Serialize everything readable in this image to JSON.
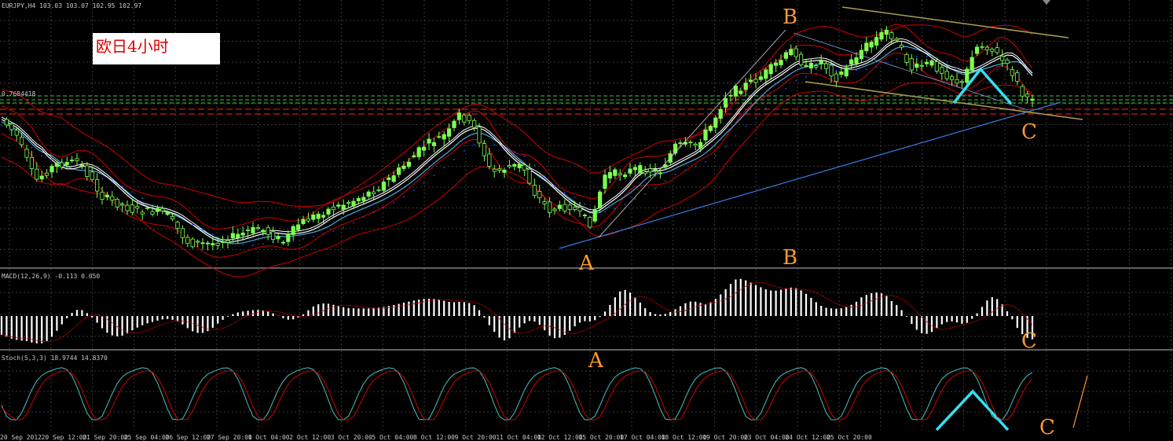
{
  "window": {
    "header_text": "EURJPY,H4  103.03 103.07 102.95 102.97",
    "price_line_label": "0.7684418"
  },
  "overlay": {
    "title": "欧日4小时"
  },
  "wave_labels": {
    "main_b": "B",
    "main_a": "A",
    "main_c": "C",
    "macd_b": "B",
    "macd_c": "C",
    "stoch_a": "A",
    "stoch_c": "C"
  },
  "indicators": {
    "macd_header": "MACD(12,26,9) -0.113 0.050",
    "stoch_header": "Stoch(5,3,3) 18.9744 14.8370"
  },
  "time_axis": {
    "labels": [
      "20 Sep 2012",
      "20 Sep 12:00",
      "21 Sep 20:00",
      "25 Sep 04:00",
      "26 Sep 12:00",
      "27 Sep 20:00",
      "1 Oct 04:00",
      "2 Oct 12:00",
      "3 Oct 20:00",
      "5 Oct 04:00",
      "8 Oct 12:00",
      "9 Oct 20:00",
      "11 Oct 04:00",
      "12 Oct 12:00",
      "15 Oct 20:00",
      "17 Oct 04:00",
      "18 Oct 12:00",
      "19 Oct 20:00",
      "23 Oct 04:00",
      "24 Oct 12:00",
      "25 Oct 20:00"
    ]
  },
  "colors": {
    "background": "#000000",
    "grid": "#3a3a3a",
    "bull_candle": "#7cff52",
    "bear_candle": "#000000",
    "bollinger": "#d00000",
    "ma_fast": "#ffffff",
    "ma_slow": "#4aa8e0",
    "macd_bars": "#ffffff",
    "macd_signal": "#c00000",
    "stoch_main": "#4ac0c0",
    "stoch_signal": "#d00000",
    "h_lines_green": "#40c040",
    "h_lines_red": "#ff2020",
    "trendline_blue": "#3a7de0",
    "channel_line": "#a8a050",
    "pattern_cyan": "#33e0f0",
    "wave_label": "#ff9a2e"
  },
  "chart_data": [
    {
      "type": "candlestick",
      "panel": "price",
      "title": "",
      "close_path": [
        {
          "x": "20 Sep 2012",
          "y": 101.7
        },
        {
          "x": "20 Sep 12:00",
          "y": 100.9
        },
        {
          "x": "21 Sep 20:00",
          "y": 100.6
        },
        {
          "x": "25 Sep 04:00",
          "y": 100.3
        },
        {
          "x": "26 Sep 12:00",
          "y": 100.0
        },
        {
          "x": "27 Sep 20:00",
          "y": 100.2
        },
        {
          "x": "1 Oct 04:00",
          "y": 100.5
        },
        {
          "x": "2 Oct 12:00",
          "y": 100.9
        },
        {
          "x": "3 Oct 20:00",
          "y": 101.5
        },
        {
          "x": "5 Oct 04:00",
          "y": 102.2
        },
        {
          "x": "8 Oct 12:00",
          "y": 101.6
        },
        {
          "x": "9 Oct 20:00",
          "y": 100.9
        },
        {
          "x": "11 Oct 04:00",
          "y": 101.4
        },
        {
          "x": "12 Oct 12:00",
          "y": 101.3
        },
        {
          "x": "15 Oct 20:00",
          "y": 102.1
        },
        {
          "x": "17 Oct 04:00",
          "y": 102.8
        },
        {
          "x": "18 Oct 12:00",
          "y": 103.1
        },
        {
          "x": "19 Oct 20:00",
          "y": 103.5
        },
        {
          "x": "23 Oct 04:00",
          "y": 103.2
        },
        {
          "x": "24 Oct 12:00",
          "y": 103.3
        },
        {
          "x": "25 Oct 20:00",
          "y": 102.97
        }
      ],
      "ylim": [
        99.8,
        104.0
      ]
    },
    {
      "type": "bar",
      "panel": "macd",
      "title": "MACD(12,26,9)",
      "values_last": {
        "main": -0.113,
        "signal": 0.05
      }
    },
    {
      "type": "line",
      "panel": "stochastic",
      "title": "Stoch(5,3,3)",
      "values_last": {
        "main": 18.9744,
        "signal": 14.837
      },
      "ylim": [
        0,
        100
      ]
    }
  ]
}
